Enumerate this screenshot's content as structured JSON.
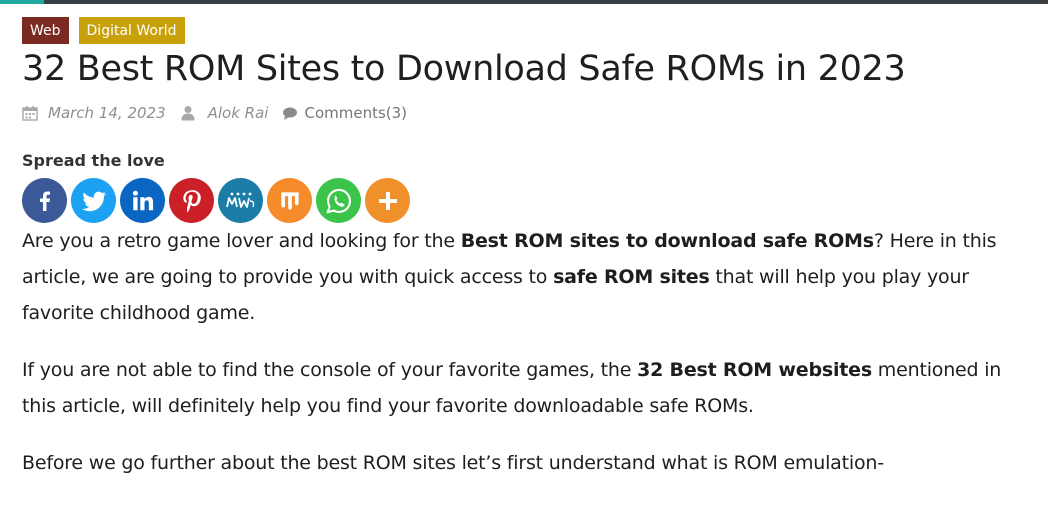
{
  "colors": {
    "category_web_bg": "#7a2a20",
    "category_digital_world_bg": "#c8a10a",
    "meta_gray": "#8f8f8f"
  },
  "categories": [
    "Web",
    "Digital World"
  ],
  "article": {
    "title": "32 Best ROM Sites to Download Safe ROMs in 2023",
    "date": "March 14, 2023",
    "author": "Alok Rai",
    "comments": "Comments(3)"
  },
  "share": {
    "heading": "Spread the love",
    "buttons": [
      {
        "name": "facebook",
        "icon": "facebook-icon",
        "color": "#3b5998"
      },
      {
        "name": "twitter",
        "icon": "twitter-icon",
        "color": "#1da1f2"
      },
      {
        "name": "linkedin",
        "icon": "linkedin-icon",
        "color": "#0a66c2"
      },
      {
        "name": "pinterest",
        "icon": "pinterest-icon",
        "color": "#cb2027"
      },
      {
        "name": "mewe",
        "icon": "mewe-icon",
        "color": "#1c7ca8"
      },
      {
        "name": "mix",
        "icon": "mix-icon",
        "color": "#f58b2a"
      },
      {
        "name": "whatsapp",
        "icon": "whatsapp-icon",
        "color": "#3cc44a"
      },
      {
        "name": "more",
        "icon": "plus-icon",
        "color": "#f0902a"
      }
    ]
  },
  "body": {
    "p1": {
      "t1": "Are you a retro game lover and looking for the ",
      "b1": "Best ROM sites to download safe ROMs",
      "t2": "? Here in this article, we are going to provide you with quick access to ",
      "b2": "safe ROM sites",
      "t3": " that will help you play your favorite childhood game."
    },
    "p2": {
      "t1": "If you are not able to find the console of your favorite games, the ",
      "b1": "32 Best ROM websites",
      "t2": " mentioned in this article, will definitely help you find your favorite downloadable safe ROMs."
    },
    "p3": "Before we go further about the best ROM sites let’s first understand what is ROM emulation-"
  }
}
